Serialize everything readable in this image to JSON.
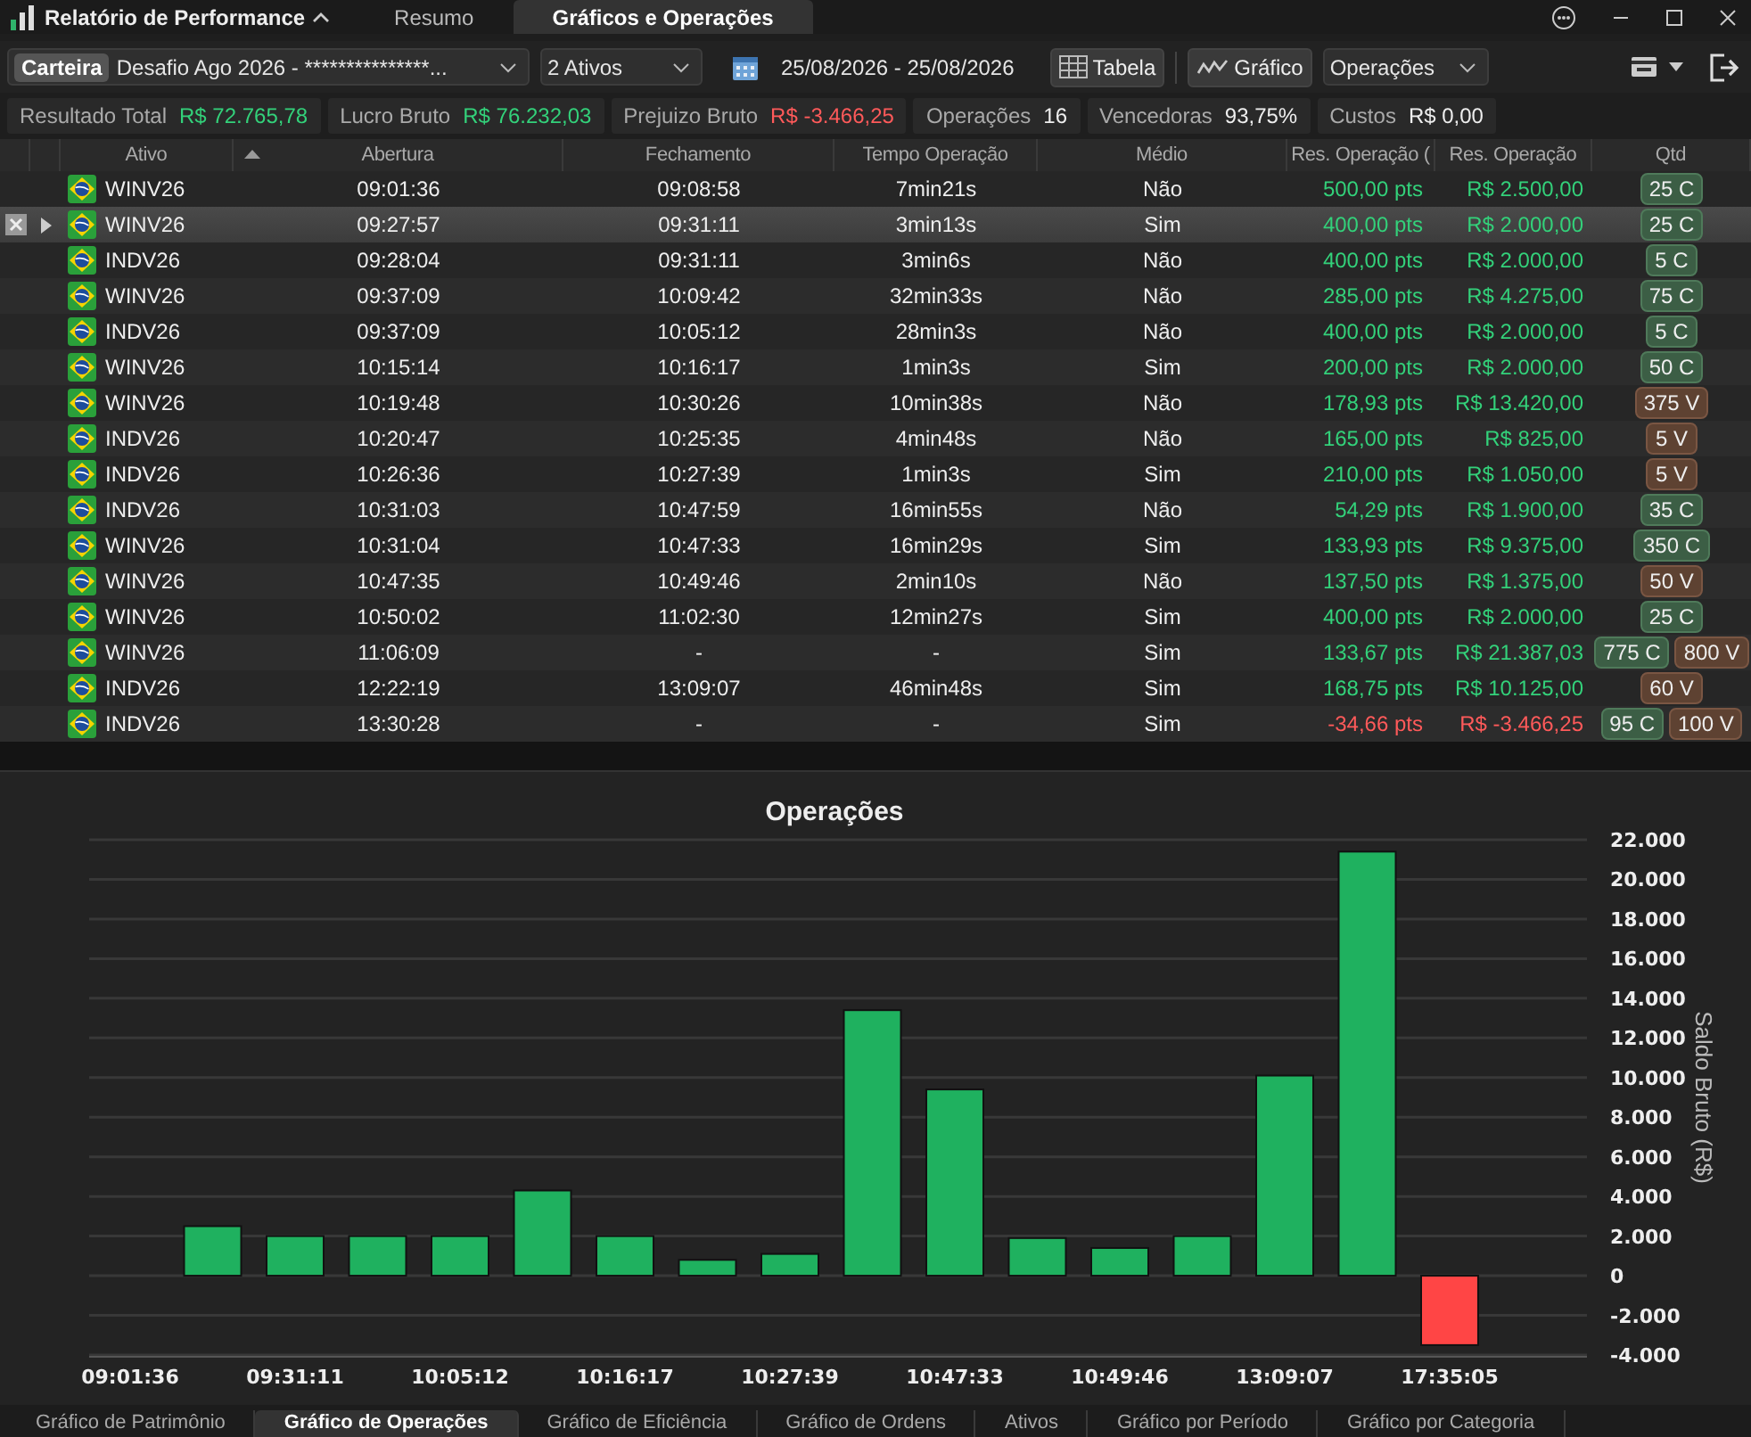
{
  "window": {
    "title": "Relatório de Performance",
    "tabs": [
      {
        "label": "Resumo",
        "selected": false
      },
      {
        "label": "Gráficos e Operações",
        "selected": true
      }
    ]
  },
  "toolbar": {
    "portfolio_label": "Carteira",
    "portfolio": "Desafio Ago 2026 - ***************...",
    "assets": "2 Ativos",
    "date_range": "25/08/2026 - 25/08/2026",
    "view_buttons": [
      {
        "label": "Tabela",
        "kind": "table"
      },
      {
        "label": "Gráfico",
        "kind": "chart"
      }
    ],
    "chart_select": "Operações"
  },
  "stats": [
    {
      "label": "Resultado Total",
      "value": "R$ 72.765,78",
      "color": "#33d17a"
    },
    {
      "label": "Lucro Bruto",
      "value": "R$ 76.232,03",
      "color": "#33d17a"
    },
    {
      "label": "Prejuizo Bruto",
      "value": "R$ -3.466,25",
      "color": "#ff5a5a"
    },
    {
      "label": "Operações",
      "value": "16",
      "color": "#eeeeee"
    },
    {
      "label": "Vencedoras",
      "value": "93,75%",
      "color": "#eeeeee"
    },
    {
      "label": "Custos",
      "value": "R$ 0,00",
      "color": "#eeeeee"
    }
  ],
  "table": {
    "columns": [
      {
        "label": "Ativo",
        "sorted": false
      },
      {
        "label": "Abertura",
        "sorted": true
      },
      {
        "label": "Fechamento",
        "sorted": false
      },
      {
        "label": "Tempo Operação",
        "sorted": false
      },
      {
        "label": "Médio",
        "sorted": false
      },
      {
        "label": "Res. Operação (",
        "sorted": false
      },
      {
        "label": "Res. Operação",
        "sorted": false
      },
      {
        "label": "Qtd",
        "sorted": false
      }
    ],
    "rows": [
      {
        "selected": false,
        "negative": false,
        "ativo": "WINV26",
        "abertura": "09:01:36",
        "fechamento": "09:08:58",
        "tempo": "7min21s",
        "medio": "Não",
        "pts": "500,00 pts",
        "valor": "R$ 2.500,00",
        "qtd": [
          {
            "text": "25 C",
            "kind": "buy"
          }
        ]
      },
      {
        "selected": true,
        "negative": false,
        "ativo": "WINV26",
        "abertura": "09:27:57",
        "fechamento": "09:31:11",
        "tempo": "3min13s",
        "medio": "Sim",
        "pts": "400,00 pts",
        "valor": "R$ 2.000,00",
        "qtd": [
          {
            "text": "25 C",
            "kind": "buy"
          }
        ]
      },
      {
        "selected": false,
        "negative": false,
        "ativo": "INDV26",
        "abertura": "09:28:04",
        "fechamento": "09:31:11",
        "tempo": "3min6s",
        "medio": "Não",
        "pts": "400,00 pts",
        "valor": "R$ 2.000,00",
        "qtd": [
          {
            "text": "5 C",
            "kind": "buy"
          }
        ]
      },
      {
        "selected": false,
        "negative": false,
        "ativo": "WINV26",
        "abertura": "09:37:09",
        "fechamento": "10:09:42",
        "tempo": "32min33s",
        "medio": "Não",
        "pts": "285,00 pts",
        "valor": "R$ 4.275,00",
        "qtd": [
          {
            "text": "75 C",
            "kind": "buy"
          }
        ]
      },
      {
        "selected": false,
        "negative": false,
        "ativo": "INDV26",
        "abertura": "09:37:09",
        "fechamento": "10:05:12",
        "tempo": "28min3s",
        "medio": "Não",
        "pts": "400,00 pts",
        "valor": "R$ 2.000,00",
        "qtd": [
          {
            "text": "5 C",
            "kind": "buy"
          }
        ]
      },
      {
        "selected": false,
        "negative": false,
        "ativo": "WINV26",
        "abertura": "10:15:14",
        "fechamento": "10:16:17",
        "tempo": "1min3s",
        "medio": "Sim",
        "pts": "200,00 pts",
        "valor": "R$ 2.000,00",
        "qtd": [
          {
            "text": "50 C",
            "kind": "buy"
          }
        ]
      },
      {
        "selected": false,
        "negative": false,
        "ativo": "WINV26",
        "abertura": "10:19:48",
        "fechamento": "10:30:26",
        "tempo": "10min38s",
        "medio": "Não",
        "pts": "178,93 pts",
        "valor": "R$ 13.420,00",
        "qtd": [
          {
            "text": "375 V",
            "kind": "sell"
          }
        ]
      },
      {
        "selected": false,
        "negative": false,
        "ativo": "INDV26",
        "abertura": "10:20:47",
        "fechamento": "10:25:35",
        "tempo": "4min48s",
        "medio": "Não",
        "pts": "165,00 pts",
        "valor": "R$ 825,00",
        "qtd": [
          {
            "text": "5 V",
            "kind": "sell"
          }
        ]
      },
      {
        "selected": false,
        "negative": false,
        "ativo": "INDV26",
        "abertura": "10:26:36",
        "fechamento": "10:27:39",
        "tempo": "1min3s",
        "medio": "Sim",
        "pts": "210,00 pts",
        "valor": "R$ 1.050,00",
        "qtd": [
          {
            "text": "5 V",
            "kind": "sell"
          }
        ]
      },
      {
        "selected": false,
        "negative": false,
        "ativo": "INDV26",
        "abertura": "10:31:03",
        "fechamento": "10:47:59",
        "tempo": "16min55s",
        "medio": "Não",
        "pts": "54,29 pts",
        "valor": "R$ 1.900,00",
        "qtd": [
          {
            "text": "35 C",
            "kind": "buy"
          }
        ]
      },
      {
        "selected": false,
        "negative": false,
        "ativo": "WINV26",
        "abertura": "10:31:04",
        "fechamento": "10:47:33",
        "tempo": "16min29s",
        "medio": "Sim",
        "pts": "133,93 pts",
        "valor": "R$ 9.375,00",
        "qtd": [
          {
            "text": "350 C",
            "kind": "buy"
          }
        ]
      },
      {
        "selected": false,
        "negative": false,
        "ativo": "WINV26",
        "abertura": "10:47:35",
        "fechamento": "10:49:46",
        "tempo": "2min10s",
        "medio": "Não",
        "pts": "137,50 pts",
        "valor": "R$ 1.375,00",
        "qtd": [
          {
            "text": "50 V",
            "kind": "sell"
          }
        ]
      },
      {
        "selected": false,
        "negative": false,
        "ativo": "WINV26",
        "abertura": "10:50:02",
        "fechamento": "11:02:30",
        "tempo": "12min27s",
        "medio": "Sim",
        "pts": "400,00 pts",
        "valor": "R$ 2.000,00",
        "qtd": [
          {
            "text": "25 C",
            "kind": "buy"
          }
        ]
      },
      {
        "selected": false,
        "negative": false,
        "ativo": "WINV26",
        "abertura": "11:06:09",
        "fechamento": "-",
        "tempo": "-",
        "medio": "Sim",
        "pts": "133,67 pts",
        "valor": "R$ 21.387,03",
        "qtd": [
          {
            "text": "775 C",
            "kind": "buy"
          },
          {
            "text": "800 V",
            "kind": "sell"
          }
        ]
      },
      {
        "selected": false,
        "negative": false,
        "ativo": "INDV26",
        "abertura": "12:22:19",
        "fechamento": "13:09:07",
        "tempo": "46min48s",
        "medio": "Sim",
        "pts": "168,75 pts",
        "valor": "R$ 10.125,00",
        "qtd": [
          {
            "text": "60 V",
            "kind": "sell"
          }
        ]
      },
      {
        "selected": false,
        "negative": true,
        "ativo": "INDV26",
        "abertura": "13:30:28",
        "fechamento": "-",
        "tempo": "-",
        "medio": "Sim",
        "pts": "-34,66 pts",
        "valor": "R$ -3.466,25",
        "qtd": [
          {
            "text": "95 C",
            "kind": "buy"
          },
          {
            "text": "100 V",
            "kind": "sell"
          }
        ]
      }
    ]
  },
  "chart": {
    "chart_data": {
      "type": "bar",
      "title": "Operações",
      "ylabel": "Saldo Bruto (R$)",
      "categories": [
        "09:01:36",
        null,
        "09:31:11",
        null,
        "10:05:12",
        null,
        "10:16:17",
        null,
        "10:27:39",
        null,
        "10:47:33",
        null,
        "10:49:46",
        null,
        "13:09:07",
        null,
        "17:35:05"
      ],
      "series": [
        {
          "color": "#1fb15f",
          "values": [
            null,
            2500,
            2000,
            2000,
            2000,
            4300,
            2000,
            800,
            1100,
            13400,
            9400,
            1900,
            1400,
            2000,
            10100,
            21400,
            null
          ]
        },
        {
          "color": "#ff4545",
          "values": [
            null,
            null,
            null,
            null,
            null,
            null,
            null,
            null,
            null,
            null,
            null,
            null,
            null,
            null,
            null,
            null,
            -3500
          ]
        }
      ],
      "stacked": true,
      "grid": true,
      "ylim": [
        -4000,
        22000
      ],
      "yticks": [
        {
          "value": 22000,
          "label": "22.000"
        },
        {
          "value": 20000,
          "label": "20.000"
        },
        {
          "value": 18000,
          "label": "18.000"
        },
        {
          "value": 16000,
          "label": "16.000"
        },
        {
          "value": 14000,
          "label": "14.000"
        },
        {
          "value": 12000,
          "label": "12.000"
        },
        {
          "value": 10000,
          "label": "10.000"
        },
        {
          "value": 8000,
          "label": "8.000"
        },
        {
          "value": 6000,
          "label": "6.000"
        },
        {
          "value": 4000,
          "label": "4.000"
        },
        {
          "value": 2000,
          "label": "2.000"
        },
        {
          "value": 0,
          "label": "0"
        },
        {
          "value": -2000,
          "label": "-2.000"
        },
        {
          "value": -4000,
          "label": "-4.000"
        }
      ]
    }
  },
  "bottom_tabs": [
    {
      "label": "Gráfico de Patrimônio",
      "selected": false
    },
    {
      "label": "Gráfico de Operações",
      "selected": true
    },
    {
      "label": "Gráfico de Eficiência",
      "selected": false
    },
    {
      "label": "Gráfico de Ordens",
      "selected": false
    },
    {
      "label": "Ativos",
      "selected": false
    },
    {
      "label": "Gráfico por Período",
      "selected": false
    },
    {
      "label": "Gráfico por Categoria",
      "selected": false
    }
  ]
}
